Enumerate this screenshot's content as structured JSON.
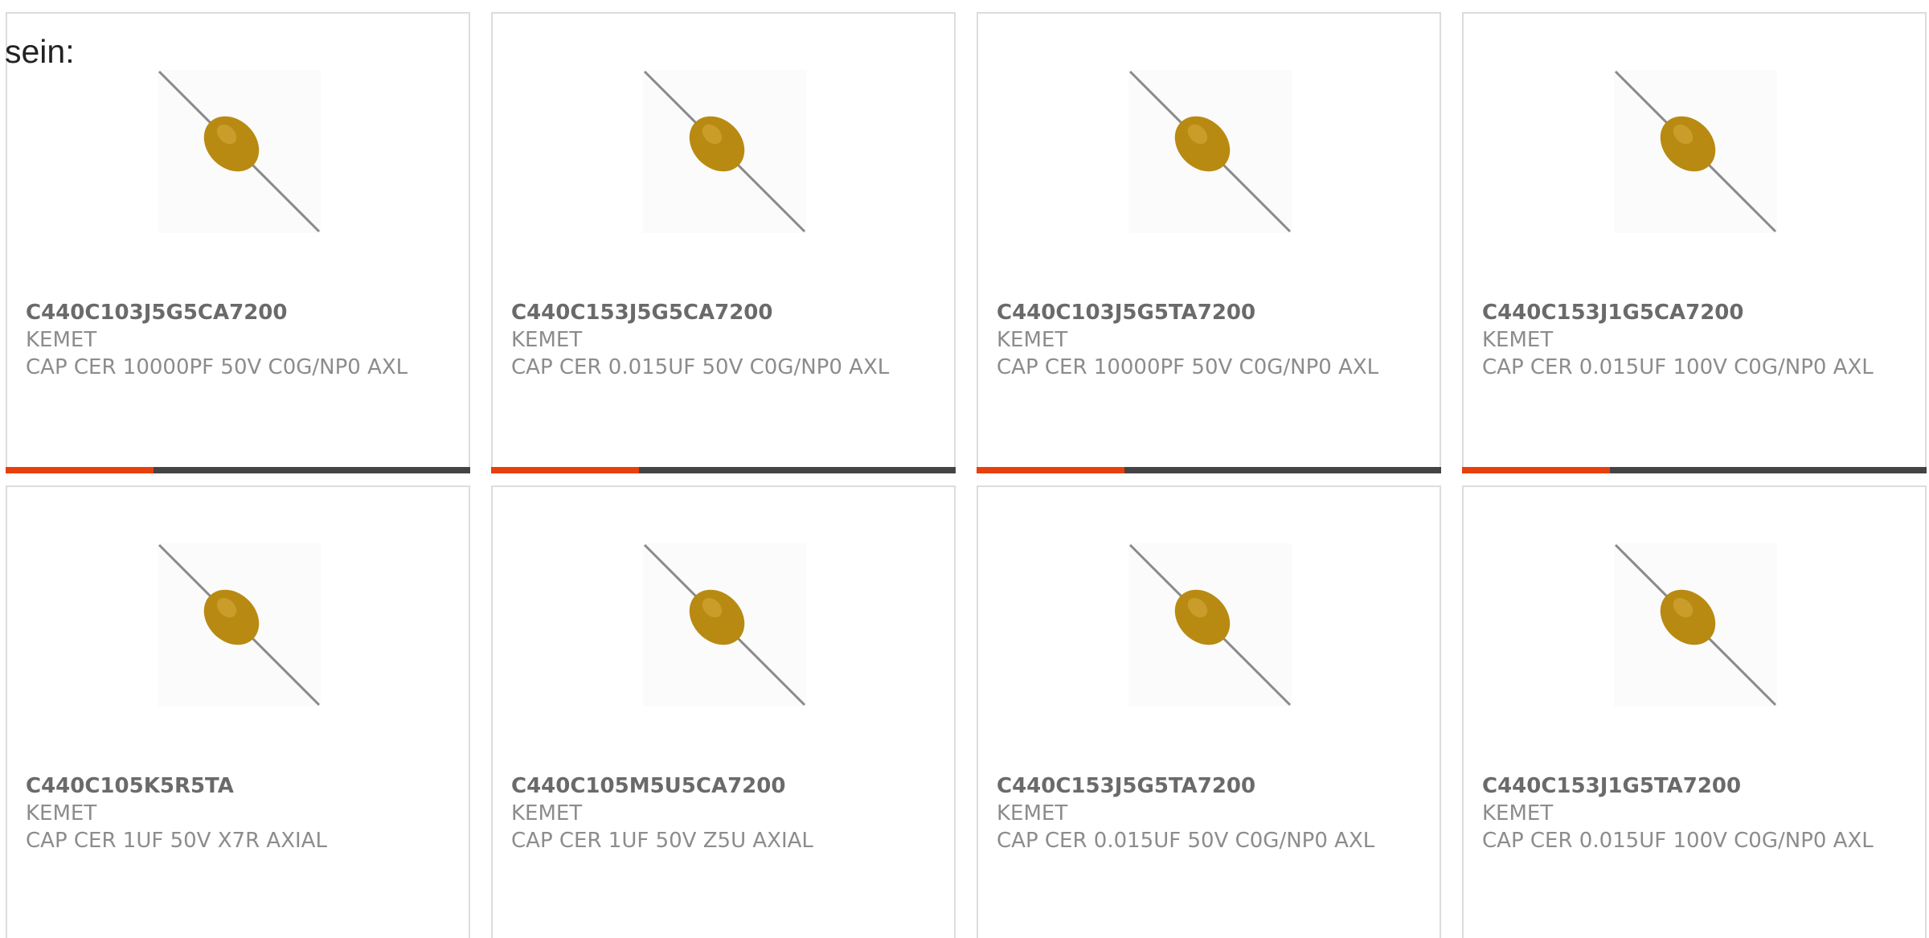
{
  "lead_text": "sein:",
  "colors": {
    "accent": "#e8400c",
    "bar": "#444444",
    "border": "#dcdcdc",
    "capacitor_body": "#b98a12",
    "lead_wire": "#8a8a8a"
  },
  "image_icon": "axial-ceramic-capacitor-icon",
  "products": [
    {
      "part_number": "C440C103J5G5CA7200",
      "manufacturer": "KEMET",
      "description": "CAP CER 10000PF 50V C0G/NP0 AXL"
    },
    {
      "part_number": "C440C153J5G5CA7200",
      "manufacturer": "KEMET",
      "description": "CAP CER 0.015UF 50V C0G/NP0 AXL"
    },
    {
      "part_number": "C440C103J5G5TA7200",
      "manufacturer": "KEMET",
      "description": "CAP CER 10000PF 50V C0G/NP0 AXL"
    },
    {
      "part_number": "C440C153J1G5CA7200",
      "manufacturer": "KEMET",
      "description": "CAP CER 0.015UF 100V C0G/NP0 AXL"
    },
    {
      "part_number": "C440C105K5R5TA",
      "manufacturer": "KEMET",
      "description": "CAP CER 1UF 50V X7R AXIAL"
    },
    {
      "part_number": "C440C105M5U5CA7200",
      "manufacturer": "KEMET",
      "description": "CAP CER 1UF 50V Z5U AXIAL"
    },
    {
      "part_number": "C440C153J5G5TA7200",
      "manufacturer": "KEMET",
      "description": "CAP CER 0.015UF 50V C0G/NP0 AXL"
    },
    {
      "part_number": "C440C153J1G5TA7200",
      "manufacturer": "KEMET",
      "description": "CAP CER 0.015UF 100V C0G/NP0 AXL"
    }
  ]
}
